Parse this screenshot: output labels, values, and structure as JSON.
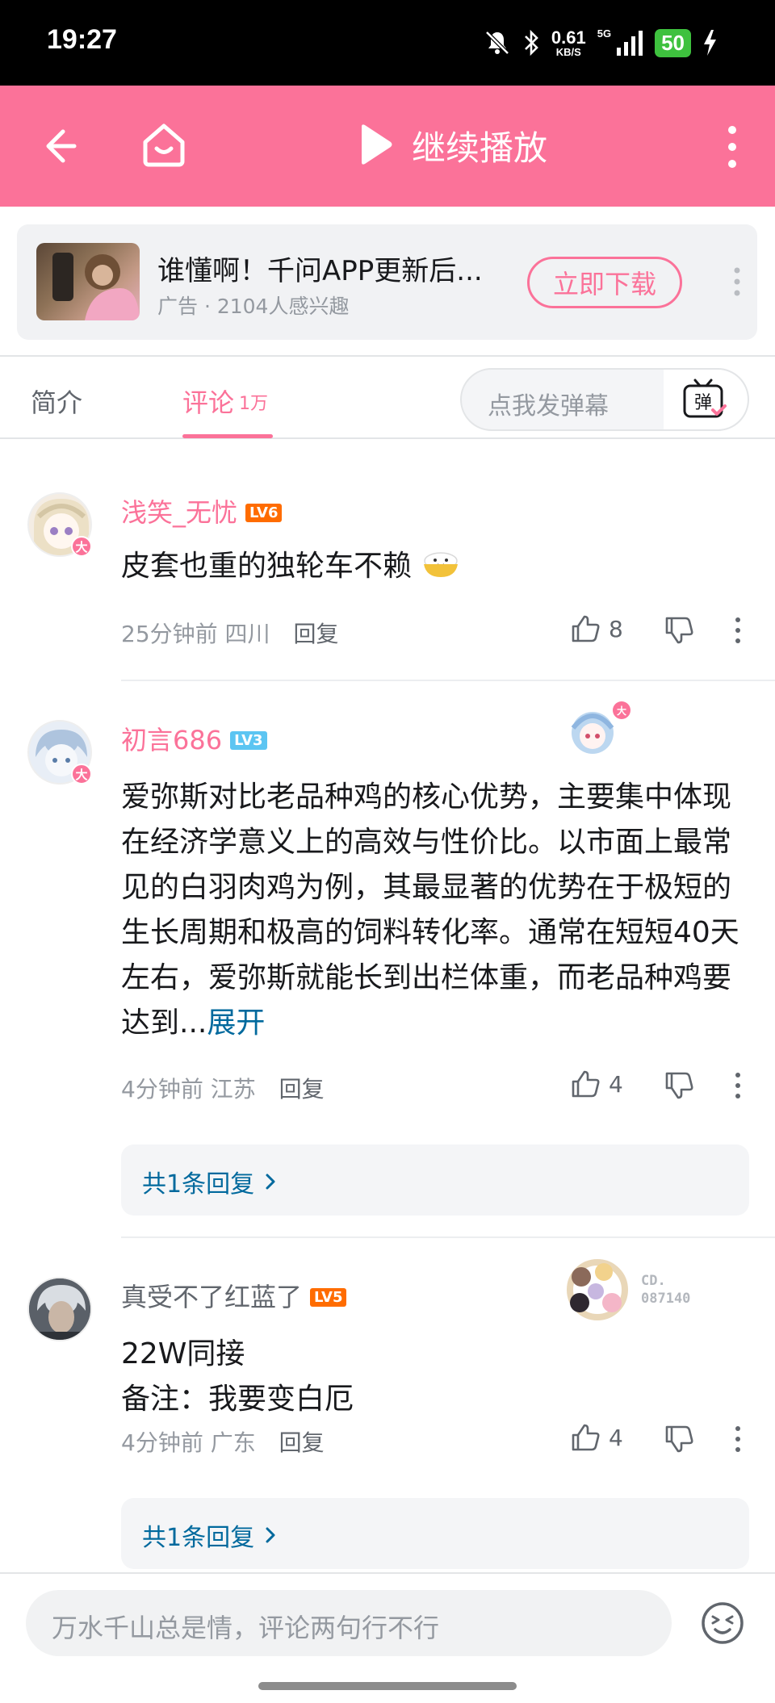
{
  "status_bar": {
    "time": "19:27",
    "net_speed": "0.61",
    "net_unit": "KB/S",
    "network": "5G",
    "battery": "50",
    "icons": [
      "bell-off-icon",
      "bluetooth-icon",
      "signal-icon",
      "charging-icon"
    ]
  },
  "top_nav": {
    "continue_play_label": "继续播放",
    "icons": [
      "back-arrow-icon",
      "home-icon",
      "play-icon",
      "more-vertical-icon"
    ],
    "background": "#fb7299"
  },
  "ad": {
    "title": "谁懂啊！千问APP更新后...",
    "subtitle": "广告 · 2104人感兴趣",
    "cta": "立即下载"
  },
  "tabs": {
    "intro": "简介",
    "comments": "评论",
    "comments_count": "1万",
    "danmaku_placeholder": "点我发弹幕",
    "danmaku_button": "弹"
  },
  "comments": [
    {
      "username": "浅笑_无忧",
      "username_color": "#fb7299",
      "level": "LV6",
      "level_color": "#ff6c00",
      "avatar_badge": "大",
      "text": "皮套也重的独轮车不赖",
      "time": "25分钟前",
      "location": "四川",
      "reply_label": "回复",
      "likes": "8"
    },
    {
      "username": "初言686",
      "username_color": "#fb7299",
      "level": "LV3",
      "level_color": "#5cc5f2",
      "avatar_badge": "大",
      "pendant_badge": "大",
      "text": "爱弥斯对比老品种鸡的核心优势，主要集中体现在经济学意义上的高效与性价比。以市面上最常见的白羽肉鸡为例，其最显著的优势在于极短的生长周期和极高的饲料转化率。通常在短短40天左右，爱弥斯就能长到出栏体重，而老品种鸡要达到...",
      "expand_label": "展开",
      "time": "4分钟前",
      "location": "江苏",
      "reply_label": "回复",
      "likes": "4",
      "replies_label": "共1条回复"
    },
    {
      "username": "真受不了红蓝了",
      "username_color": "#61666d",
      "level": "LV5",
      "level_color": "#ff6c00",
      "pendant_code": "CD.\n087140",
      "text_line1": "22W同接",
      "text_line2": "备注：我要变白厄",
      "time": "4分钟前",
      "location": "广东",
      "reply_label": "回复",
      "likes": "4",
      "replies_label": "共1条回复"
    }
  ],
  "bottom_bar": {
    "placeholder": "万水千山总是情，评论两句行不行"
  }
}
